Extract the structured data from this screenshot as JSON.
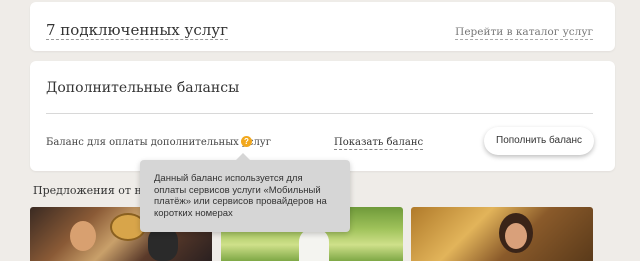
{
  "services": {
    "title": "7 подключенных услуг",
    "catalog_link": "Перейти в каталог услуг"
  },
  "balances": {
    "title": "Дополнительные балансы",
    "label": "Баланс для оплаты дополнительных услуг",
    "help_icon": "question-icon",
    "show_balance": "Показать баланс",
    "topup_button": "Пополнить баланс"
  },
  "tooltip": {
    "text": "Данный баланс используется для оплаты сервисов услуги «Мобильный платёж» или сервисов провайдеров на коротких номерах"
  },
  "offers": {
    "title": "Предложения от наших партнеров"
  },
  "colors": {
    "page_background": "#efece8",
    "card_background": "#ffffff",
    "help_icon": "#f2a81d",
    "tooltip_background": "#d6d6d6"
  }
}
